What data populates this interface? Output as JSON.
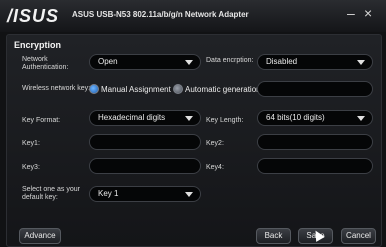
{
  "window": {
    "brand": "/ISUS",
    "title": "ASUS USB-N53 802.11a/b/g/n Network Adapter",
    "minimize_glyph": "–",
    "close_glyph": "×"
  },
  "section_title": "Encryption",
  "fields": {
    "network_auth": {
      "label": "Network Authentication:",
      "value": "Open"
    },
    "data_encryption": {
      "label": "Data encrption:",
      "value": "Disabled"
    },
    "wireless_key": {
      "label": "Wireless network key:",
      "option_manual": "Manual Assignment",
      "option_auto": "Automatic generation",
      "selected": "Manual Assignment",
      "value": ""
    },
    "key_format": {
      "label": "Key Format:",
      "value": "Hexadecimal digits"
    },
    "key_length": {
      "label": "Key Length:",
      "value": "64 bits(10 digits)"
    },
    "key1": {
      "label": "Key1:",
      "value": ""
    },
    "key2": {
      "label": "Key2:",
      "value": ""
    },
    "key3": {
      "label": "Key3:",
      "value": ""
    },
    "key4": {
      "label": "Key4:",
      "value": ""
    },
    "default_key": {
      "label": "Select one as your default key:",
      "value": "Key 1"
    }
  },
  "buttons": {
    "advance": "Advance",
    "back": "Back",
    "save": "Save",
    "cancel": "Cancel"
  },
  "icons": [
    "chevron-down-icon",
    "radio-selected-icon",
    "radio-unselected-icon",
    "cursor-icon"
  ]
}
